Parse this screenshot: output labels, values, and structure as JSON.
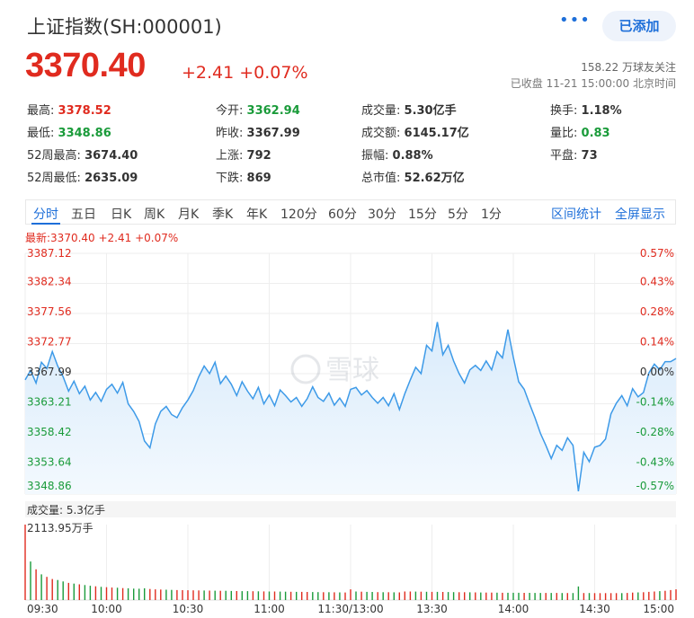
{
  "header": {
    "title": "上证指数(SH:000001)",
    "menu_dots": "•••",
    "added_button": "已添加",
    "price": "3370.40",
    "change": "+2.41 +0.07%",
    "followers": "158.22 万球友关注",
    "status": "已收盘 11-21 15:00:00 北京时间"
  },
  "stats": {
    "high_label": "最高:",
    "high": "3378.52",
    "low_label": "最低:",
    "low": "3348.86",
    "w52_high_label": "52周最高:",
    "w52_high": "3674.40",
    "w52_low_label": "52周最低:",
    "w52_low": "2635.09",
    "open_label": "今开:",
    "open": "3362.94",
    "prev_close_label": "昨收:",
    "prev_close": "3367.99",
    "up_label": "上涨:",
    "up": "792",
    "down_label": "下跌:",
    "down": "869",
    "volume_label": "成交量:",
    "volume": "5.30亿手",
    "amount_label": "成交额:",
    "amount": "6145.17亿",
    "amplitude_label": "振幅:",
    "amplitude": "0.88%",
    "market_cap_label": "总市值:",
    "market_cap": "52.62万亿",
    "turnover_label": "换手:",
    "turnover": "1.18%",
    "volume_ratio_label": "量比:",
    "volume_ratio": "0.83",
    "flat_label": "平盘:",
    "flat": "73"
  },
  "tabs": [
    "分时",
    "五日",
    "日K",
    "周K",
    "月K",
    "季K",
    "年K",
    "120分",
    "60分",
    "30分",
    "15分",
    "5分",
    "1分"
  ],
  "active_tab": "分时",
  "links": {
    "range_stats": "区间统计",
    "fullscreen": "全屏显示"
  },
  "latest": "最新:3370.40 +2.41 +0.07%",
  "watermark": "雪球",
  "colors": {
    "up": "#e02b1f",
    "down": "#1a9b3a",
    "accent": "#1e6fd9",
    "line": "#3d9ae8",
    "fill": "#eaf4fd"
  },
  "chart_data": {
    "type": "line",
    "title": "",
    "series_name": "分时",
    "prev_close": 3367.99,
    "ylim": [
      3348.86,
      3387.12
    ],
    "y_ticks": [
      "3387.12",
      "3382.34",
      "3377.56",
      "3372.77",
      "3367.99",
      "3363.21",
      "3358.42",
      "3353.64",
      "3348.86"
    ],
    "pct_ticks": [
      "0.57%",
      "0.43%",
      "0.28%",
      "0.14%",
      "0.00%",
      "-0.14%",
      "-0.28%",
      "-0.43%",
      "-0.57%"
    ],
    "x_ticks": [
      "09:30",
      "10:00",
      "10:30",
      "11:00",
      "11:30/13:00",
      "13:30",
      "14:00",
      "14:30",
      "15:00"
    ],
    "x_index_range": [
      0,
      240
    ],
    "price_points": [
      [
        0,
        3367.0
      ],
      [
        2,
        3368.5
      ],
      [
        4,
        3366.5
      ],
      [
        6,
        3369.8
      ],
      [
        8,
        3368.8
      ],
      [
        10,
        3371.5
      ],
      [
        12,
        3369.2
      ],
      [
        14,
        3367.5
      ],
      [
        16,
        3365.2
      ],
      [
        18,
        3366.8
      ],
      [
        20,
        3364.8
      ],
      [
        22,
        3366.0
      ],
      [
        24,
        3363.8
      ],
      [
        26,
        3365.0
      ],
      [
        28,
        3363.6
      ],
      [
        30,
        3365.5
      ],
      [
        32,
        3366.3
      ],
      [
        34,
        3364.9
      ],
      [
        36,
        3366.6
      ],
      [
        38,
        3363.2
      ],
      [
        40,
        3362.0
      ],
      [
        42,
        3360.4
      ],
      [
        44,
        3357.3
      ],
      [
        46,
        3356.2
      ],
      [
        48,
        3360.0
      ],
      [
        50,
        3362.0
      ],
      [
        52,
        3362.8
      ],
      [
        54,
        3361.5
      ],
      [
        56,
        3361.0
      ],
      [
        58,
        3362.6
      ],
      [
        60,
        3363.8
      ],
      [
        62,
        3365.3
      ],
      [
        64,
        3367.5
      ],
      [
        66,
        3369.2
      ],
      [
        68,
        3368.0
      ],
      [
        70,
        3369.8
      ],
      [
        72,
        3366.4
      ],
      [
        74,
        3367.6
      ],
      [
        76,
        3366.3
      ],
      [
        78,
        3364.5
      ],
      [
        80,
        3366.7
      ],
      [
        82,
        3365.2
      ],
      [
        84,
        3364.0
      ],
      [
        86,
        3365.8
      ],
      [
        88,
        3363.2
      ],
      [
        90,
        3364.6
      ],
      [
        92,
        3362.9
      ],
      [
        94,
        3365.4
      ],
      [
        96,
        3364.5
      ],
      [
        98,
        3363.5
      ],
      [
        100,
        3364.2
      ],
      [
        102,
        3362.8
      ],
      [
        104,
        3364.0
      ],
      [
        106,
        3365.9
      ],
      [
        108,
        3364.2
      ],
      [
        110,
        3363.6
      ],
      [
        112,
        3364.9
      ],
      [
        114,
        3363.0
      ],
      [
        116,
        3364.1
      ],
      [
        118,
        3362.8
      ],
      [
        120,
        3365.5
      ],
      [
        122,
        3365.8
      ],
      [
        124,
        3364.6
      ],
      [
        126,
        3365.3
      ],
      [
        128,
        3364.2
      ],
      [
        130,
        3363.3
      ],
      [
        132,
        3364.2
      ],
      [
        134,
        3362.9
      ],
      [
        136,
        3364.8
      ],
      [
        138,
        3362.3
      ],
      [
        140,
        3364.8
      ],
      [
        142,
        3367.0
      ],
      [
        144,
        3369.0
      ],
      [
        146,
        3368.0
      ],
      [
        148,
        3372.5
      ],
      [
        150,
        3371.6
      ],
      [
        152,
        3376.2
      ],
      [
        154,
        3371.0
      ],
      [
        156,
        3372.5
      ],
      [
        158,
        3370.0
      ],
      [
        160,
        3368.0
      ],
      [
        162,
        3366.5
      ],
      [
        164,
        3368.6
      ],
      [
        166,
        3369.3
      ],
      [
        168,
        3368.5
      ],
      [
        170,
        3370.0
      ],
      [
        172,
        3368.6
      ],
      [
        174,
        3371.5
      ],
      [
        176,
        3370.5
      ],
      [
        178,
        3375.0
      ],
      [
        180,
        3370.6
      ],
      [
        182,
        3366.7
      ],
      [
        184,
        3365.5
      ],
      [
        186,
        3363.2
      ],
      [
        188,
        3361.0
      ],
      [
        190,
        3358.5
      ],
      [
        192,
        3356.6
      ],
      [
        194,
        3354.5
      ],
      [
        196,
        3356.6
      ],
      [
        198,
        3355.8
      ],
      [
        200,
        3357.8
      ],
      [
        202,
        3356.6
      ],
      [
        204,
        3349.3
      ],
      [
        206,
        3355.5
      ],
      [
        208,
        3354.0
      ],
      [
        210,
        3356.3
      ],
      [
        212,
        3356.6
      ],
      [
        214,
        3357.6
      ],
      [
        216,
        3361.6
      ],
      [
        218,
        3363.3
      ],
      [
        220,
        3364.5
      ],
      [
        222,
        3362.9
      ],
      [
        224,
        3365.6
      ],
      [
        226,
        3364.3
      ],
      [
        228,
        3365.0
      ],
      [
        230,
        3368.1
      ],
      [
        232,
        3369.5
      ],
      [
        234,
        3368.6
      ],
      [
        236,
        3369.9
      ],
      [
        238,
        3369.9
      ],
      [
        240,
        3370.4
      ]
    ],
    "volume_label": "成交量: 5.3亿手",
    "volume_max_label": "2113.95万手",
    "volume_max": 2113.95,
    "volume_bars": [
      [
        0,
        2114,
        "up"
      ],
      [
        2,
        1080,
        "down"
      ],
      [
        4,
        860,
        "up"
      ],
      [
        6,
        720,
        "down"
      ],
      [
        8,
        650,
        "up"
      ],
      [
        10,
        590,
        "up"
      ],
      [
        12,
        560,
        "down"
      ],
      [
        14,
        520,
        "down"
      ],
      [
        16,
        480,
        "up"
      ],
      [
        18,
        460,
        "down"
      ],
      [
        20,
        440,
        "up"
      ],
      [
        22,
        420,
        "down"
      ],
      [
        24,
        400,
        "down"
      ],
      [
        26,
        385,
        "up"
      ],
      [
        28,
        370,
        "down"
      ],
      [
        30,
        360,
        "up"
      ],
      [
        32,
        350,
        "up"
      ],
      [
        34,
        345,
        "down"
      ],
      [
        36,
        335,
        "up"
      ],
      [
        38,
        330,
        "down"
      ],
      [
        40,
        320,
        "down"
      ],
      [
        42,
        318,
        "down"
      ],
      [
        44,
        330,
        "down"
      ],
      [
        46,
        310,
        "up"
      ],
      [
        48,
        300,
        "up"
      ],
      [
        50,
        295,
        "up"
      ],
      [
        52,
        290,
        "down"
      ],
      [
        54,
        285,
        "down"
      ],
      [
        56,
        280,
        "up"
      ],
      [
        58,
        278,
        "up"
      ],
      [
        60,
        275,
        "up"
      ],
      [
        62,
        272,
        "up"
      ],
      [
        64,
        270,
        "up"
      ],
      [
        66,
        268,
        "down"
      ],
      [
        68,
        265,
        "up"
      ],
      [
        70,
        262,
        "down"
      ],
      [
        72,
        260,
        "up"
      ],
      [
        74,
        258,
        "down"
      ],
      [
        76,
        255,
        "down"
      ],
      [
        78,
        252,
        "up"
      ],
      [
        80,
        250,
        "down"
      ],
      [
        82,
        248,
        "down"
      ],
      [
        84,
        246,
        "up"
      ],
      [
        86,
        244,
        "down"
      ],
      [
        88,
        242,
        "up"
      ],
      [
        90,
        240,
        "down"
      ],
      [
        92,
        238,
        "up"
      ],
      [
        94,
        236,
        "down"
      ],
      [
        96,
        234,
        "down"
      ],
      [
        98,
        232,
        "up"
      ],
      [
        100,
        230,
        "down"
      ],
      [
        102,
        228,
        "up"
      ],
      [
        104,
        226,
        "up"
      ],
      [
        106,
        224,
        "down"
      ],
      [
        108,
        222,
        "down"
      ],
      [
        110,
        220,
        "up"
      ],
      [
        112,
        218,
        "down"
      ],
      [
        114,
        216,
        "up"
      ],
      [
        116,
        214,
        "down"
      ],
      [
        118,
        212,
        "up"
      ],
      [
        120,
        300,
        "up"
      ],
      [
        122,
        240,
        "down"
      ],
      [
        124,
        235,
        "up"
      ],
      [
        126,
        230,
        "down"
      ],
      [
        128,
        226,
        "down"
      ],
      [
        130,
        222,
        "up"
      ],
      [
        132,
        220,
        "down"
      ],
      [
        134,
        218,
        "up"
      ],
      [
        136,
        216,
        "down"
      ],
      [
        138,
        214,
        "up"
      ],
      [
        140,
        240,
        "up"
      ],
      [
        142,
        238,
        "up"
      ],
      [
        144,
        236,
        "down"
      ],
      [
        146,
        234,
        "up"
      ],
      [
        148,
        232,
        "down"
      ],
      [
        150,
        230,
        "up"
      ],
      [
        152,
        228,
        "down"
      ],
      [
        154,
        226,
        "up"
      ],
      [
        156,
        224,
        "down"
      ],
      [
        158,
        222,
        "down"
      ],
      [
        160,
        220,
        "up"
      ],
      [
        162,
        218,
        "up"
      ],
      [
        164,
        216,
        "down"
      ],
      [
        166,
        214,
        "up"
      ],
      [
        168,
        212,
        "down"
      ],
      [
        170,
        210,
        "up"
      ],
      [
        172,
        208,
        "up"
      ],
      [
        174,
        206,
        "down"
      ],
      [
        176,
        205,
        "up"
      ],
      [
        178,
        204,
        "down"
      ],
      [
        180,
        204,
        "down"
      ],
      [
        182,
        203,
        "down"
      ],
      [
        184,
        202,
        "up"
      ],
      [
        186,
        201,
        "down"
      ],
      [
        188,
        200,
        "down"
      ],
      [
        190,
        200,
        "down"
      ],
      [
        192,
        199,
        "up"
      ],
      [
        194,
        198,
        "down"
      ],
      [
        196,
        198,
        "up"
      ],
      [
        198,
        197,
        "down"
      ],
      [
        200,
        197,
        "up"
      ],
      [
        202,
        196,
        "down"
      ],
      [
        204,
        380,
        "down"
      ],
      [
        206,
        196,
        "up"
      ],
      [
        208,
        196,
        "down"
      ],
      [
        210,
        195,
        "up"
      ],
      [
        212,
        195,
        "up"
      ],
      [
        214,
        195,
        "up"
      ],
      [
        216,
        195,
        "up"
      ],
      [
        218,
        195,
        "up"
      ],
      [
        220,
        195,
        "down"
      ],
      [
        222,
        200,
        "up"
      ],
      [
        224,
        210,
        "up"
      ],
      [
        226,
        215,
        "down"
      ],
      [
        228,
        220,
        "up"
      ],
      [
        230,
        230,
        "up"
      ],
      [
        232,
        240,
        "up"
      ],
      [
        234,
        250,
        "down"
      ],
      [
        236,
        260,
        "up"
      ],
      [
        238,
        280,
        "up"
      ],
      [
        240,
        300,
        "up"
      ]
    ]
  }
}
